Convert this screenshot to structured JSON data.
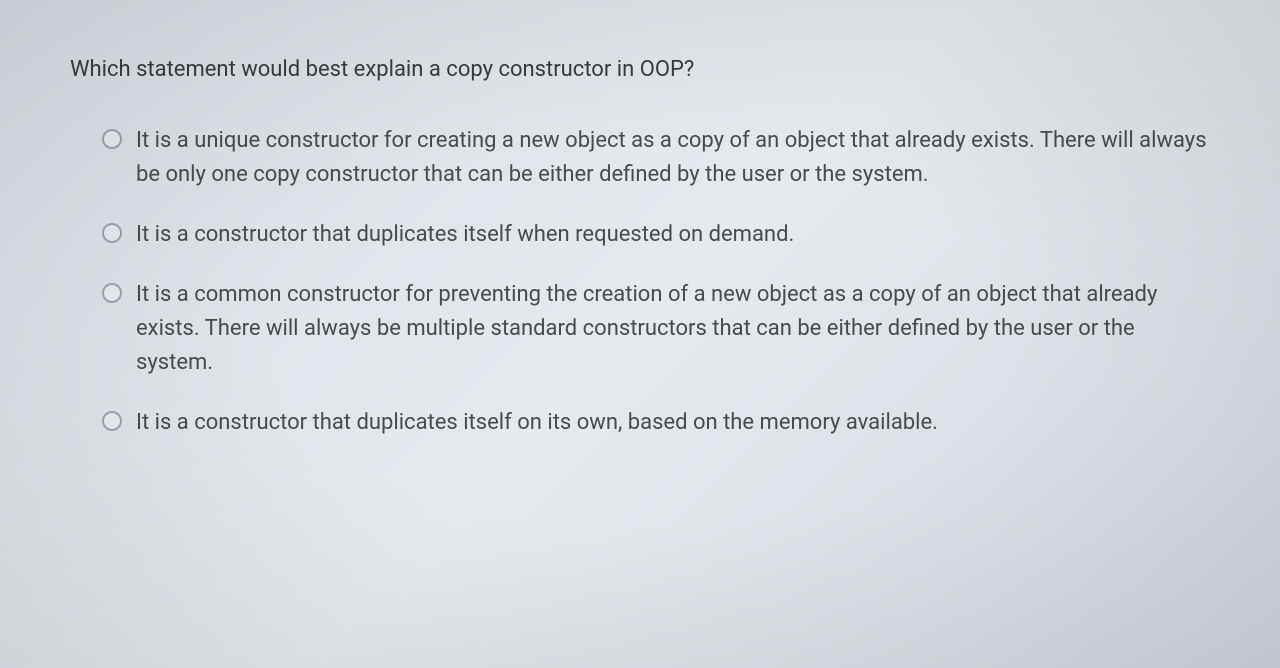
{
  "question": {
    "prompt": "Which statement would best explain a copy constructor in OOP?",
    "options": [
      {
        "text": "It is a unique constructor for creating a new object as a copy of an object that already exists. There will always be only one copy constructor that can be either defined by the user or the system."
      },
      {
        "text": "It is a constructor that duplicates itself when requested on demand."
      },
      {
        "text": "It is a common constructor for preventing the creation of a new object as a copy of an object that already exists. There will always be multiple standard constructors that can be either defined by the user or the system."
      },
      {
        "text": "It is a constructor that duplicates itself on its own, based on the memory available."
      }
    ]
  }
}
